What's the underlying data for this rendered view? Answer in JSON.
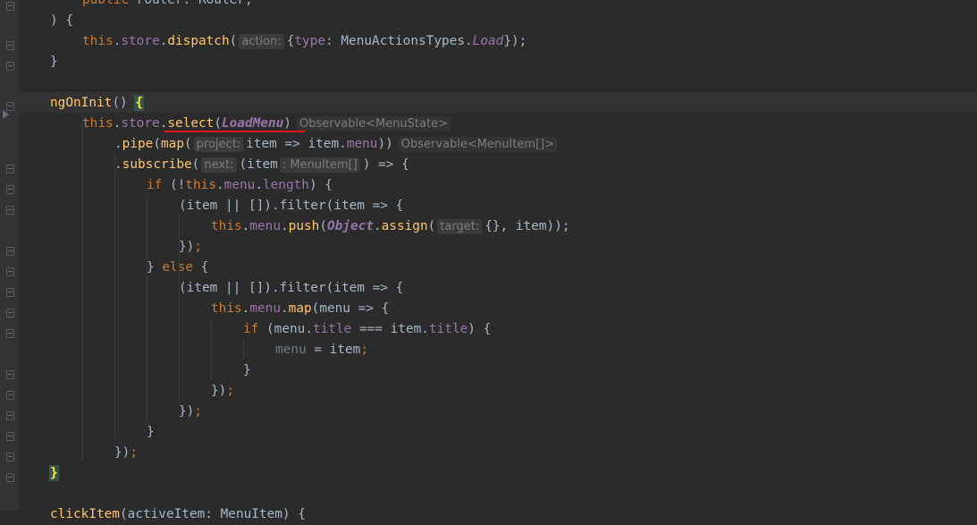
{
  "editor": {
    "lines": [
      {
        "tokens": [
          [
            "kw",
            "public "
          ],
          [
            "pl",
            "router: Router;"
          ]
        ]
      },
      {
        "tokens": [
          [
            "pl",
            ") {"
          ]
        ]
      },
      {
        "tokens": [
          [
            "kw",
            "this"
          ],
          [
            "pl",
            "."
          ],
          [
            "fld",
            "store"
          ],
          [
            "pl",
            "."
          ],
          [
            "fn",
            "dispatch"
          ],
          [
            "pl",
            "("
          ],
          [
            "hint",
            "action:"
          ],
          [
            "pl",
            "{"
          ],
          [
            "fld",
            "type"
          ],
          [
            "pl",
            ": MenuActionsTypes."
          ],
          [
            "cst",
            "Load"
          ],
          [
            "pl",
            "});"
          ]
        ]
      },
      {
        "tokens": [
          [
            "pl",
            "}"
          ]
        ]
      },
      {
        "tokens": []
      },
      {
        "tokens": [
          [
            "fn",
            "ngOnInit"
          ],
          [
            "pl",
            "() "
          ],
          [
            "brace",
            "{"
          ]
        ]
      },
      {
        "tokens": [
          [
            "kw",
            "this"
          ],
          [
            "pl",
            "."
          ],
          [
            "fld",
            "store"
          ],
          [
            "pl",
            "."
          ],
          [
            "fn",
            "select"
          ],
          [
            "pl",
            "("
          ],
          [
            "ital",
            "LoadMenu"
          ],
          [
            "pl",
            ")"
          ],
          [
            "hintt",
            "Observable<MenuState>"
          ]
        ]
      },
      {
        "tokens": [
          [
            "pl",
            "."
          ],
          [
            "fn",
            "pipe"
          ],
          [
            "pl",
            "("
          ],
          [
            "fn",
            "map"
          ],
          [
            "pl",
            "("
          ],
          [
            "hint",
            "project:"
          ],
          [
            "pl",
            "item => item."
          ],
          [
            "fld",
            "menu"
          ],
          [
            "pl",
            "))"
          ],
          [
            "hintt",
            "Observable<MenuItem[]>"
          ]
        ]
      },
      {
        "tokens": [
          [
            "pl",
            "."
          ],
          [
            "fn",
            "subscribe"
          ],
          [
            "pl",
            "("
          ],
          [
            "hint",
            "next:"
          ],
          [
            "pl",
            "(item"
          ],
          [
            "hint",
            ": MenuItem[]"
          ],
          [
            "pl",
            ") => {"
          ]
        ]
      },
      {
        "tokens": [
          [
            "kw",
            "if "
          ],
          [
            "pl",
            "(!"
          ],
          [
            "kw",
            "this"
          ],
          [
            "pl",
            "."
          ],
          [
            "fld",
            "menu"
          ],
          [
            "pl",
            "."
          ],
          [
            "fld",
            "length"
          ],
          [
            "pl",
            ") {"
          ]
        ]
      },
      {
        "tokens": [
          [
            "pl",
            "(item || []).filter(item => {"
          ]
        ]
      },
      {
        "tokens": [
          [
            "kw",
            "this"
          ],
          [
            "pl",
            "."
          ],
          [
            "fld",
            "menu"
          ],
          [
            "pl",
            "."
          ],
          [
            "fn",
            "push"
          ],
          [
            "pl",
            "("
          ],
          [
            "ital",
            "Object"
          ],
          [
            "pl",
            "."
          ],
          [
            "fn",
            "assign"
          ],
          [
            "pl",
            "("
          ],
          [
            "hint",
            "target:"
          ],
          [
            "pl",
            "{}, item));"
          ]
        ]
      },
      {
        "tokens": [
          [
            "pl",
            "})"
          ],
          [
            "kw",
            ";"
          ]
        ]
      },
      {
        "tokens": [
          [
            "pl",
            "} "
          ],
          [
            "kw",
            "else "
          ],
          [
            "pl",
            "{"
          ]
        ]
      },
      {
        "tokens": [
          [
            "pl",
            "(item || []).filter(item => {"
          ]
        ]
      },
      {
        "tokens": [
          [
            "kw",
            "this"
          ],
          [
            "pl",
            "."
          ],
          [
            "fld",
            "menu"
          ],
          [
            "pl",
            "."
          ],
          [
            "fn",
            "map"
          ],
          [
            "pl",
            "(menu => {"
          ]
        ]
      },
      {
        "tokens": [
          [
            "kw",
            "if "
          ],
          [
            "pl",
            "(menu."
          ],
          [
            "fld",
            "title"
          ],
          [
            "pl",
            " === item."
          ],
          [
            "fld",
            "title"
          ],
          [
            "pl",
            ") {"
          ]
        ]
      },
      {
        "tokens": [
          [
            "dim",
            "menu"
          ],
          [
            "pl",
            " = item"
          ],
          [
            "kw",
            ";"
          ]
        ]
      },
      {
        "tokens": [
          [
            "pl",
            "}"
          ]
        ]
      },
      {
        "tokens": [
          [
            "pl",
            "})"
          ],
          [
            "kw",
            ";"
          ]
        ]
      },
      {
        "tokens": [
          [
            "pl",
            "})"
          ],
          [
            "kw",
            ";"
          ]
        ]
      },
      {
        "tokens": [
          [
            "pl",
            "}"
          ]
        ]
      },
      {
        "tokens": [
          [
            "pl",
            "})"
          ],
          [
            "kw",
            ";"
          ]
        ]
      },
      {
        "tokens": [
          [
            "brace",
            "}"
          ]
        ]
      },
      {
        "tokens": []
      },
      {
        "tokens": [
          [
            "fn",
            "clickItem"
          ],
          [
            "pl",
            "(activeItem: MenuItem) {"
          ]
        ]
      }
    ],
    "indents": [
      1,
      0,
      1,
      0,
      0,
      0,
      1,
      2,
      2,
      3,
      4,
      5,
      4,
      3,
      4,
      5,
      6,
      7,
      6,
      5,
      4,
      3,
      2,
      0,
      0,
      0
    ],
    "colors": {
      "background": "#2b2b2b",
      "keyword": "#cc7832",
      "function": "#ffc66d",
      "field": "#9876aa",
      "text": "#a9b7c6",
      "error_underline": "#e3151a"
    }
  }
}
